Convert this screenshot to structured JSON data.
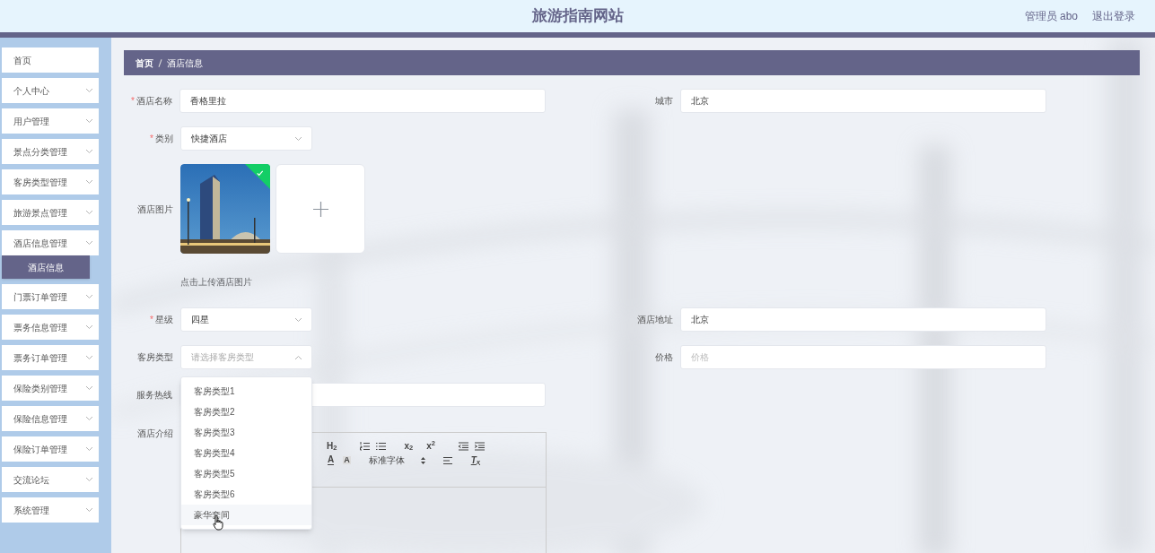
{
  "header": {
    "title": "旅游指南网站",
    "user": "管理员 abo",
    "logout": "退出登录"
  },
  "sidebar": {
    "items": [
      {
        "label": "首页",
        "kind": "link"
      },
      {
        "label": "个人中心",
        "kind": "submenu"
      },
      {
        "label": "用户管理",
        "kind": "submenu"
      },
      {
        "label": "景点分类管理",
        "kind": "submenu"
      },
      {
        "label": "客房类型管理",
        "kind": "submenu"
      },
      {
        "label": "旅游景点管理",
        "kind": "submenu"
      },
      {
        "label": "酒店信息管理",
        "kind": "submenu",
        "children": [
          {
            "label": "酒店信息",
            "selected": true
          }
        ]
      },
      {
        "label": "门票订单管理",
        "kind": "submenu"
      },
      {
        "label": "票务信息管理",
        "kind": "submenu"
      },
      {
        "label": "票务订单管理",
        "kind": "submenu"
      },
      {
        "label": "保险类别管理",
        "kind": "submenu"
      },
      {
        "label": "保险信息管理",
        "kind": "submenu"
      },
      {
        "label": "保险订单管理",
        "kind": "submenu"
      },
      {
        "label": "交流论坛",
        "kind": "submenu"
      },
      {
        "label": "系统管理",
        "kind": "submenu"
      }
    ]
  },
  "breadcrumb": [
    "首页",
    "酒店信息"
  ],
  "form": [
    {
      "kind": "pair",
      "fields": [
        {
          "kind": "input",
          "label": "酒店名称",
          "required_mark": "*",
          "value": "香格里拉"
        },
        {
          "kind": "input",
          "label": "城市",
          "value": "北京"
        }
      ]
    },
    {
      "kind": "pair",
      "fields": [
        {
          "kind": "select",
          "label": "类别",
          "required_mark": "*",
          "value": "快捷酒店",
          "open": false
        }
      ]
    },
    {
      "kind": "image-upload",
      "label": "酒店图片",
      "images": [
        {
          "kind": "picture",
          "uploaded": true
        }
      ],
      "hint": "点击上传酒店图片"
    },
    {
      "kind": "pair",
      "fields": [
        {
          "kind": "select",
          "label": "星级",
          "required_mark": "*",
          "value": "四星",
          "open": false
        },
        {
          "kind": "input",
          "label": "酒店地址",
          "value": "北京"
        }
      ]
    },
    {
      "kind": "pair",
      "fields": [
        {
          "kind": "select",
          "label": "客房类型",
          "placeholder": "请选择客房类型",
          "open": true,
          "options": [
            {
              "label": "客房类型1",
              "hovered": false
            },
            {
              "label": "客房类型2",
              "hovered": false
            },
            {
              "label": "客房类型3",
              "hovered": false
            },
            {
              "label": "客房类型4",
              "hovered": false
            },
            {
              "label": "客房类型5",
              "hovered": false
            },
            {
              "label": "客房类型6",
              "hovered": false
            },
            {
              "label": "豪华套间",
              "hovered": true
            }
          ]
        },
        {
          "kind": "input",
          "label": "价格",
          "placeholder": "价格"
        }
      ]
    },
    {
      "kind": "pair",
      "fields": [
        {
          "kind": "input",
          "label": "服务热线"
        }
      ]
    },
    {
      "kind": "editor",
      "label": "酒店介绍",
      "toolbar": [
        [
          {
            "kind": "text",
            "label": "H$_{2}$"
          },
          {
            "kind": "ordered-list"
          },
          {
            "kind": "bullet-list"
          },
          {
            "kind": "text",
            "label": "x$_{2}$"
          },
          {
            "kind": "text",
            "label": "x$^{2}$"
          },
          {
            "kind": "outdent"
          },
          {
            "kind": "indent"
          }
        ],
        [
          {
            "kind": "color",
            "label": "A"
          },
          {
            "kind": "background",
            "label": "A"
          },
          {
            "kind": "font",
            "label": "标准字体"
          },
          {
            "kind": "align"
          },
          {
            "kind": "clean",
            "label": "T$_{x}$"
          }
        ]
      ]
    }
  ]
}
